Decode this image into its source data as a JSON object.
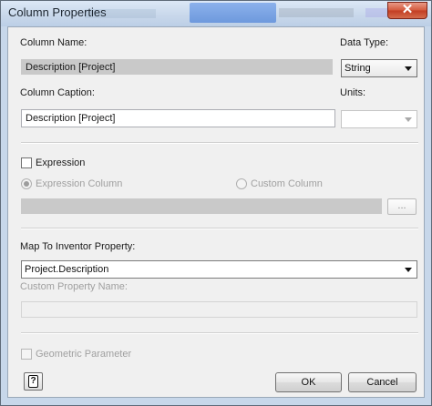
{
  "window": {
    "title": "Column Properties",
    "close_symbol": "✕"
  },
  "fields": {
    "column_name_label": "Column Name:",
    "column_name_value": "Description [Project]",
    "data_type_label": "Data Type:",
    "data_type_value": "String",
    "column_caption_label": "Column Caption:",
    "column_caption_value": "Description [Project]",
    "units_label": "Units:",
    "units_value": ""
  },
  "expression": {
    "label": "Expression",
    "checked": false,
    "expression_column_label": "Expression Column",
    "custom_column_label": "Custom Column",
    "ellipsis_button_label": "..."
  },
  "mapping": {
    "label": "Map To Inventor Property:",
    "selected_value": "Project.Description",
    "custom_property_name_label": "Custom Property Name:",
    "custom_property_name_value": ""
  },
  "geometric": {
    "label": "Geometric Parameter",
    "checked": false
  },
  "buttons": {
    "ok": "OK",
    "cancel": "Cancel"
  },
  "icons": {
    "close": "close-icon",
    "dropdown": "chevron-down-icon",
    "help": "help-icon"
  }
}
